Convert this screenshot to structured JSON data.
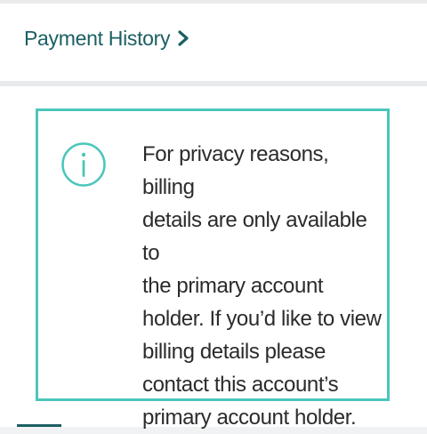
{
  "payment_history": {
    "label": "Payment History"
  },
  "icons": {
    "chevron": "chevron-right-icon",
    "info": "info-icon"
  },
  "info_box": {
    "lines": [
      "For privacy reasons, billing",
      "details are only available to",
      "the primary account",
      "holder. If you’d like to view",
      "billing details please",
      "contact this account’s",
      "primary account holder."
    ]
  },
  "colors": {
    "accent": "#1b5f63",
    "border": "#4bc6bb",
    "text": "#2b2b2b",
    "background": "#f1f2f3"
  }
}
